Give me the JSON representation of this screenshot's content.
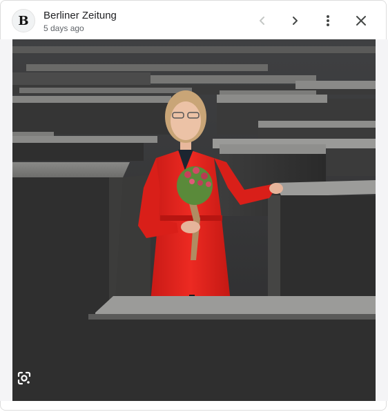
{
  "header": {
    "source_name": "Berliner Zeitung",
    "time_ago": "5 days ago",
    "logo_glyph": "B"
  },
  "icons": {
    "prev": "chevron-left-icon",
    "next": "chevron-right-icon",
    "more": "more-vert-icon",
    "close": "close-icon",
    "lens": "google-lens-icon"
  },
  "colors": {
    "coat_red": "#e8231e",
    "stele_gray": "#4a4a4a",
    "disabled_icon": "#c4c7c5",
    "icon": "#444746"
  }
}
